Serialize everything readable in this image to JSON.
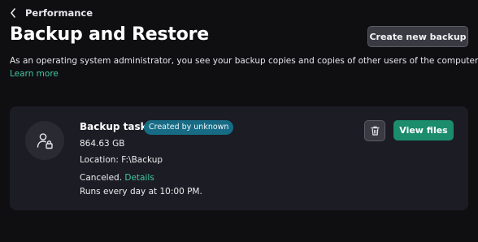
{
  "nav": {
    "back_label": "Performance",
    "back_icon": "chevron-left-icon"
  },
  "header": {
    "title": "Backup and Restore",
    "create_button": "Create new backup"
  },
  "intro": {
    "description": "As an operating system administrator, you see your backup copies and copies of other users of the computer.",
    "learn_more": "Learn more"
  },
  "backup": {
    "icon": "user-lock-icon",
    "title": "Backup task",
    "badge": "Created by unknown",
    "size": "864.63 GB",
    "location": "Location: F:\\Backup",
    "status": "Canceled.",
    "details_link": "Details",
    "schedule": "Runs every day at 10:00 PM.",
    "delete_icon": "trash-icon",
    "view_button": "View files"
  },
  "colors": {
    "background": "#0f0f12",
    "card": "#1c1c24",
    "accent_green": "#1b8c6c",
    "link_green": "#3ec9a0",
    "badge_blue": "#176b85"
  }
}
